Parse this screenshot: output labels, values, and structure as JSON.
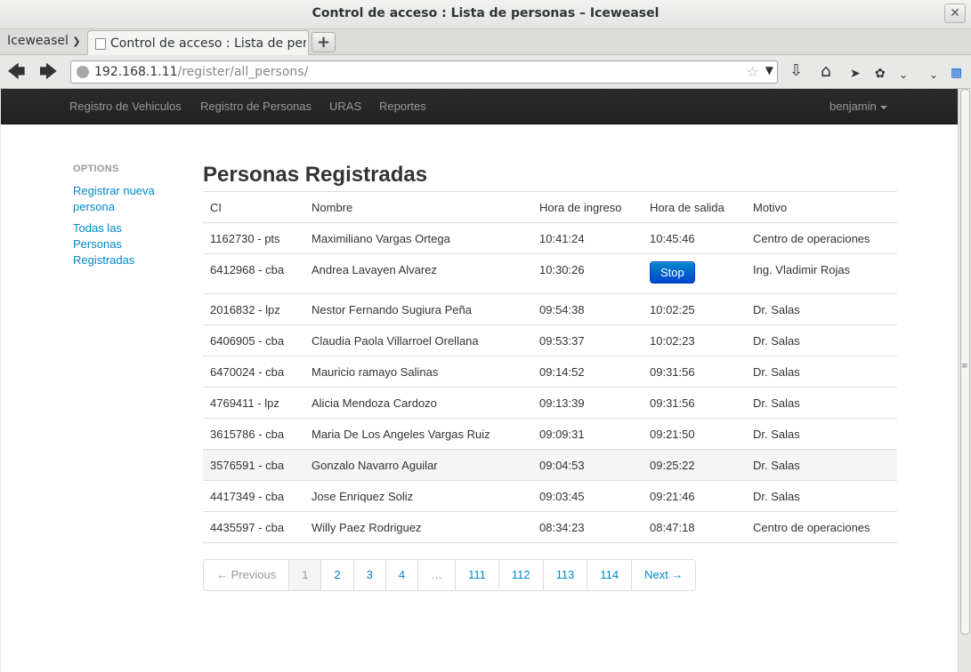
{
  "window": {
    "title": "Control de acceso : Lista de personas – Iceweasel",
    "close": "✕"
  },
  "browser": {
    "app_menu": "Iceweasel",
    "tab_title": "Control de acceso : Lista de personas",
    "new_tab": "+",
    "url_host": "192.168.1.11",
    "url_path": "/register/all_persons/"
  },
  "topnav": {
    "items": [
      "Registro de Vehiculos",
      "Registro de Personas",
      "URAS",
      "Reportes"
    ],
    "user": "benjamin"
  },
  "sidebar": {
    "header": "OPTIONS",
    "links": [
      "Registrar nueva persona",
      "Todas las Personas Registradas"
    ]
  },
  "page": {
    "title": "Personas Registradas",
    "columns": [
      "CI",
      "Nombre",
      "Hora de ingreso",
      "Hora de salida",
      "Motivo"
    ],
    "stop_label": "Stop",
    "rows": [
      {
        "ci": "1162730 - pts",
        "nombre": "Maximiliano Vargas Ortega",
        "ingreso": "10:41:24",
        "salida": "10:45:46",
        "motivo": "Centro de operaciones"
      },
      {
        "ci": "6412968 - cba",
        "nombre": "Andrea Lavayen Alvarez",
        "ingreso": "10:30:26",
        "salida": "",
        "motivo": "Ing. Vladimir Rojas"
      },
      {
        "ci": "2016832 - lpz",
        "nombre": "Nestor Fernando Sugiura Peña",
        "ingreso": "09:54:38",
        "salida": "10:02:25",
        "motivo": "Dr. Salas"
      },
      {
        "ci": "6406905 - cba",
        "nombre": "Claudia Paola Villarroel Orellana",
        "ingreso": "09:53:37",
        "salida": "10:02:23",
        "motivo": "Dr. Salas"
      },
      {
        "ci": "6470024 - cba",
        "nombre": "Mauricio ramayo Salinas",
        "ingreso": "09:14:52",
        "salida": "09:31:56",
        "motivo": "Dr. Salas"
      },
      {
        "ci": "4769411 - lpz",
        "nombre": "Alicia Mendoza Cardozo",
        "ingreso": "09:13:39",
        "salida": "09:31:56",
        "motivo": "Dr. Salas"
      },
      {
        "ci": "3615786 - cba",
        "nombre": "Maria De Los Angeles Vargas Ruiz",
        "ingreso": "09:09:31",
        "salida": "09:21:50",
        "motivo": "Dr. Salas"
      },
      {
        "ci": "3576591 - cba",
        "nombre": "Gonzalo Navarro Aguilar",
        "ingreso": "09:04:53",
        "salida": "09:25:22",
        "motivo": "Dr. Salas"
      },
      {
        "ci": "4417349 - cba",
        "nombre": "Jose Enriquez Soliz",
        "ingreso": "09:03:45",
        "salida": "09:21:46",
        "motivo": "Dr. Salas"
      },
      {
        "ci": "4435597 - cba",
        "nombre": "Willy Paez Rodriguez",
        "ingreso": "08:34:23",
        "salida": "08:47:18",
        "motivo": "Centro de operaciones"
      }
    ]
  },
  "pagination": {
    "previous": "← Previous",
    "pages": [
      "1",
      "2",
      "3",
      "4",
      "…",
      "111",
      "112",
      "113",
      "114"
    ],
    "next": "Next →"
  }
}
